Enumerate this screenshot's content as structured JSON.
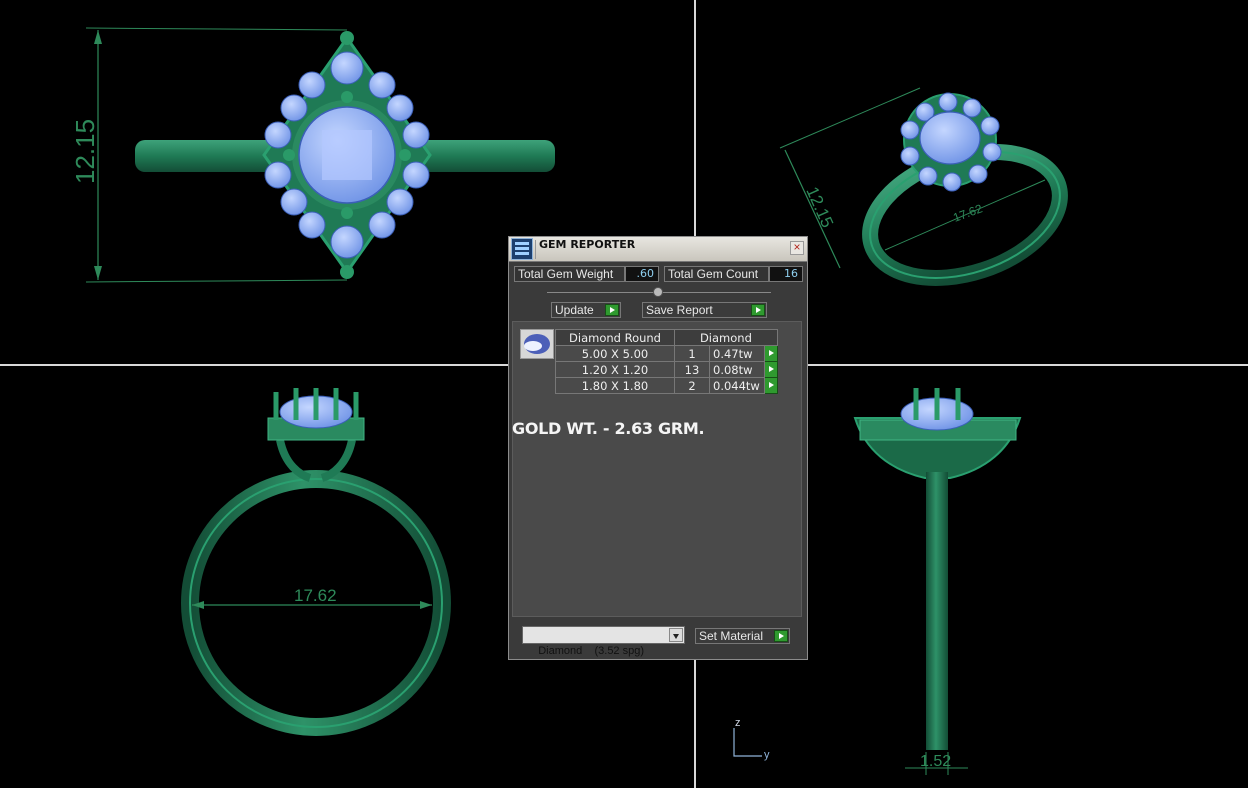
{
  "viewports": {
    "top_height_dim": "12.15",
    "iso_height_dim": "12.15",
    "iso_diameter_dim": "17.62",
    "front_diameter_dim": "17.62",
    "side_width_dim": "1.52",
    "axis_z": "z",
    "axis_y": "y"
  },
  "dialog": {
    "title": "GEM REPORTER",
    "close_symbol": "×",
    "total_gem_weight_label": "Total Gem Weight",
    "total_gem_weight_value": ".60",
    "total_gem_count_label": "Total Gem Count",
    "total_gem_count_value": "16",
    "update_label": "Update",
    "save_report_label": "Save Report",
    "table": {
      "header": [
        "Diamond Round",
        "Diamond"
      ],
      "rows": [
        {
          "size": "5.00 X 5.00",
          "count": "1",
          "weight": "0.47tw"
        },
        {
          "size": "1.20 X 1.20",
          "count": "13",
          "weight": "0.08tw"
        },
        {
          "size": "1.80 X 1.80",
          "count": "2",
          "weight": "0.044tw"
        }
      ]
    },
    "note": "GOLD WT. - 2.63 GRM.",
    "material_select": "Diamond    (3.52 spg)",
    "set_material_label": "Set Material"
  },
  "colors": {
    "metal": "#1f7a55",
    "gem": "#8fb2f5",
    "grid_line": "#d9d9d9"
  }
}
